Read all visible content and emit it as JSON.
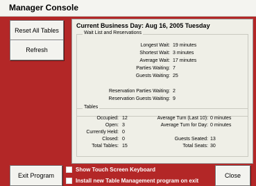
{
  "window": {
    "title": "Manager Console"
  },
  "buttons": {
    "reset_all_tables": "Reset All Tables",
    "refresh": "Refresh",
    "exit_program": "Exit Program",
    "close": "Close"
  },
  "business_day": "Current Business Day: Aug 16, 2005  Tuesday",
  "wait_list": {
    "group_label": "Wait List and Reservations",
    "longest_wait_label": "Longest Wait:",
    "longest_wait_value": "19 minutes",
    "shortest_wait_label": "Shortest Wait:",
    "shortest_wait_value": "3  minutes",
    "average_wait_label": "Average Wait:",
    "average_wait_value": "17 minutes",
    "parties_waiting_label": "Parties Waiting:",
    "parties_waiting_value": "7",
    "guests_waiting_label": "Guests Waiting:",
    "guests_waiting_value": "25",
    "reservation_parties_label": "Reservation Parties Waiting:",
    "reservation_parties_value": "2",
    "reservation_guests_label": "Reservation Guests Waiting:",
    "reservation_guests_value": "9"
  },
  "tables": {
    "group_label": "Tables",
    "occupied_label": "Occupied:",
    "occupied_value": "12",
    "open_label": "Open:",
    "open_value": "3",
    "currently_held_label": "Currently Held:",
    "currently_held_value": "0",
    "closed_label": "Closed:",
    "closed_value": "0",
    "total_tables_label": "Total Tables:",
    "total_tables_value": "15",
    "avg_turn_last10_label": "Average Turn (Last 10):",
    "avg_turn_last10_value": "0 minutes",
    "avg_turn_day_label": "Average Turn for Day:",
    "avg_turn_day_value": "0 minutes",
    "guests_seated_label": "Guests Seated:",
    "guests_seated_value": "13",
    "total_seats_label": "Total Seats:",
    "total_seats_value": "30"
  },
  "options": {
    "show_keyboard": "Show Touch Screen Keyboard",
    "install_program": "Install new Table Management program on exit"
  },
  "colors": {
    "background": "#b32727",
    "panel": "#efefe7",
    "titlebar": "#f4f4f0"
  }
}
